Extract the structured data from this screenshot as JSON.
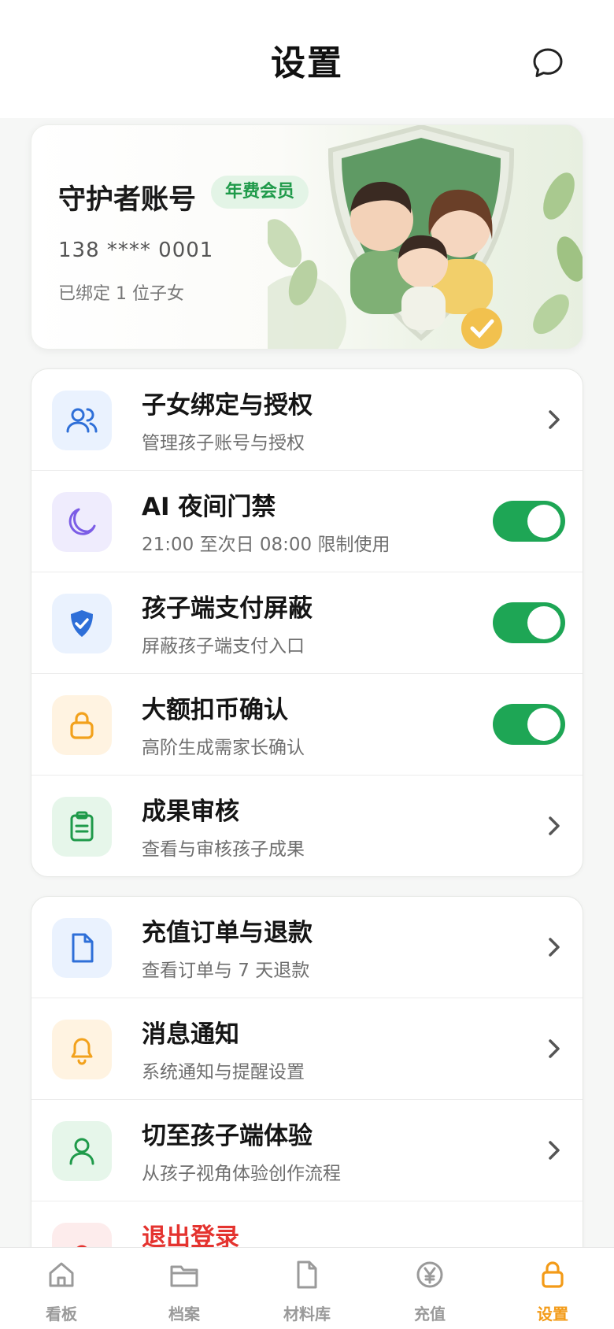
{
  "header": {
    "title": "设置",
    "message_icon": "chat-bubble-icon"
  },
  "account": {
    "name": "守护者账号",
    "badge": "年费会员",
    "phone": "138 **** 0001",
    "bound": "已绑定 1 位子女",
    "art": "family-shield-illustration"
  },
  "group1": [
    {
      "label": "子女绑定与授权",
      "sub": "管理孩子账号与授权",
      "icon": "users-icon",
      "control": "chevron"
    },
    {
      "label": "AI 夜间门禁",
      "sub": "21:00 至次日 08:00 限制使用",
      "icon": "moon-icon",
      "control": "toggle",
      "on": true
    },
    {
      "label": "孩子端支付屏蔽",
      "sub": "屏蔽孩子端支付入口",
      "icon": "shield-check-icon",
      "control": "toggle",
      "on": true
    },
    {
      "label": "大额扣币确认",
      "sub": "高阶生成需家长确认",
      "icon": "lock-icon",
      "control": "toggle",
      "on": true
    },
    {
      "label": "成果审核",
      "sub": "查看与审核孩子成果",
      "icon": "clipboard-icon",
      "control": "chevron"
    }
  ],
  "group2": [
    {
      "label": "充值订单与退款",
      "sub": "查看订单与 7 天退款",
      "icon": "document-icon",
      "control": "chevron"
    },
    {
      "label": "消息通知",
      "sub": "系统通知与提醒设置",
      "icon": "bell-icon",
      "control": "chevron"
    },
    {
      "label": "切至孩子端体验",
      "sub": "从孩子视角体验创作流程",
      "icon": "user-icon",
      "control": "chevron"
    },
    {
      "label": "退出登录",
      "icon": "logout-icon"
    }
  ],
  "tabs": [
    {
      "label": "看板",
      "icon": "home-icon"
    },
    {
      "label": "档案",
      "icon": "folder-icon"
    },
    {
      "label": "材料库",
      "icon": "file-icon"
    },
    {
      "label": "充值",
      "icon": "yen-icon"
    },
    {
      "label": "设置",
      "icon": "lock-icon",
      "active": true
    }
  ],
  "colors": {
    "accent_green": "#1ea655",
    "active_tab": "#f39b18",
    "danger": "#e4332f"
  }
}
